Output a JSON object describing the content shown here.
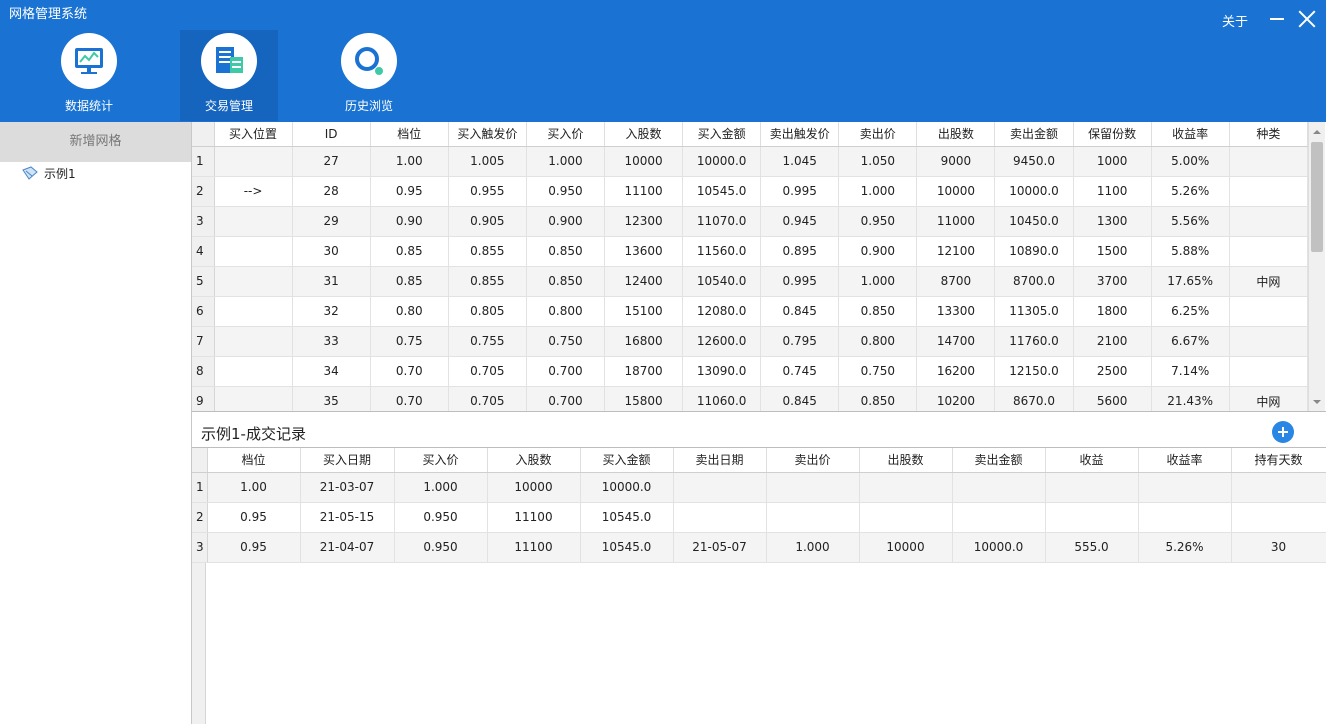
{
  "app": {
    "title": "网格管理系统",
    "about": "关于"
  },
  "nav": [
    {
      "label": "数据统计",
      "icon": "monitor-chart-icon"
    },
    {
      "label": "交易管理",
      "icon": "document-icon"
    },
    {
      "label": "历史浏览",
      "icon": "search-icon"
    }
  ],
  "sidebar": {
    "add_label": "新增网格",
    "items": [
      {
        "label": "示例1",
        "icon": "grid-file-icon"
      }
    ]
  },
  "grid_table": {
    "columns": [
      "",
      "买入位置",
      "ID",
      "档位",
      "买入触发价",
      "买入价",
      "入股数",
      "买入金额",
      "卖出触发价",
      "卖出价",
      "出股数",
      "卖出金额",
      "保留份数",
      "收益率",
      "种类"
    ],
    "rows": [
      [
        "1",
        "",
        "27",
        "1.00",
        "1.005",
        "1.000",
        "10000",
        "10000.0",
        "1.045",
        "1.050",
        "9000",
        "9450.0",
        "1000",
        "5.00%",
        ""
      ],
      [
        "2",
        "-->",
        "28",
        "0.95",
        "0.955",
        "0.950",
        "11100",
        "10545.0",
        "0.995",
        "1.000",
        "10000",
        "10000.0",
        "1100",
        "5.26%",
        ""
      ],
      [
        "3",
        "",
        "29",
        "0.90",
        "0.905",
        "0.900",
        "12300",
        "11070.0",
        "0.945",
        "0.950",
        "11000",
        "10450.0",
        "1300",
        "5.56%",
        ""
      ],
      [
        "4",
        "",
        "30",
        "0.85",
        "0.855",
        "0.850",
        "13600",
        "11560.0",
        "0.895",
        "0.900",
        "12100",
        "10890.0",
        "1500",
        "5.88%",
        ""
      ],
      [
        "5",
        "",
        "31",
        "0.85",
        "0.855",
        "0.850",
        "12400",
        "10540.0",
        "0.995",
        "1.000",
        "8700",
        "8700.0",
        "3700",
        "17.65%",
        "中网"
      ],
      [
        "6",
        "",
        "32",
        "0.80",
        "0.805",
        "0.800",
        "15100",
        "12080.0",
        "0.845",
        "0.850",
        "13300",
        "11305.0",
        "1800",
        "6.25%",
        ""
      ],
      [
        "7",
        "",
        "33",
        "0.75",
        "0.755",
        "0.750",
        "16800",
        "12600.0",
        "0.795",
        "0.800",
        "14700",
        "11760.0",
        "2100",
        "6.67%",
        ""
      ],
      [
        "8",
        "",
        "34",
        "0.70",
        "0.705",
        "0.700",
        "18700",
        "13090.0",
        "0.745",
        "0.750",
        "16200",
        "12150.0",
        "2500",
        "7.14%",
        ""
      ],
      [
        "9",
        "",
        "35",
        "0.70",
        "0.705",
        "0.700",
        "15800",
        "11060.0",
        "0.845",
        "0.850",
        "10200",
        "8670.0",
        "5600",
        "21.43%",
        "中网"
      ]
    ]
  },
  "trades": {
    "title": "示例1-成交记录",
    "columns": [
      "",
      "档位",
      "买入日期",
      "买入价",
      "入股数",
      "买入金额",
      "卖出日期",
      "卖出价",
      "出股数",
      "卖出金额",
      "收益",
      "收益率",
      "持有天数"
    ],
    "rows": [
      [
        "1",
        "1.00",
        "21-03-07",
        "1.000",
        "10000",
        "10000.0",
        "",
        "",
        "",
        "",
        "",
        "",
        ""
      ],
      [
        "2",
        "0.95",
        "21-05-15",
        "0.950",
        "11100",
        "10545.0",
        "",
        "",
        "",
        "",
        "",
        "",
        ""
      ],
      [
        "3",
        "0.95",
        "21-04-07",
        "0.950",
        "11100",
        "10545.0",
        "21-05-07",
        "1.000",
        "10000",
        "10000.0",
        "555.0",
        "5.26%",
        "30"
      ]
    ]
  },
  "colors": {
    "header_bg": "#1a73d2",
    "active_tab_bg": "#1565bf",
    "accent": "#2a86e4"
  }
}
